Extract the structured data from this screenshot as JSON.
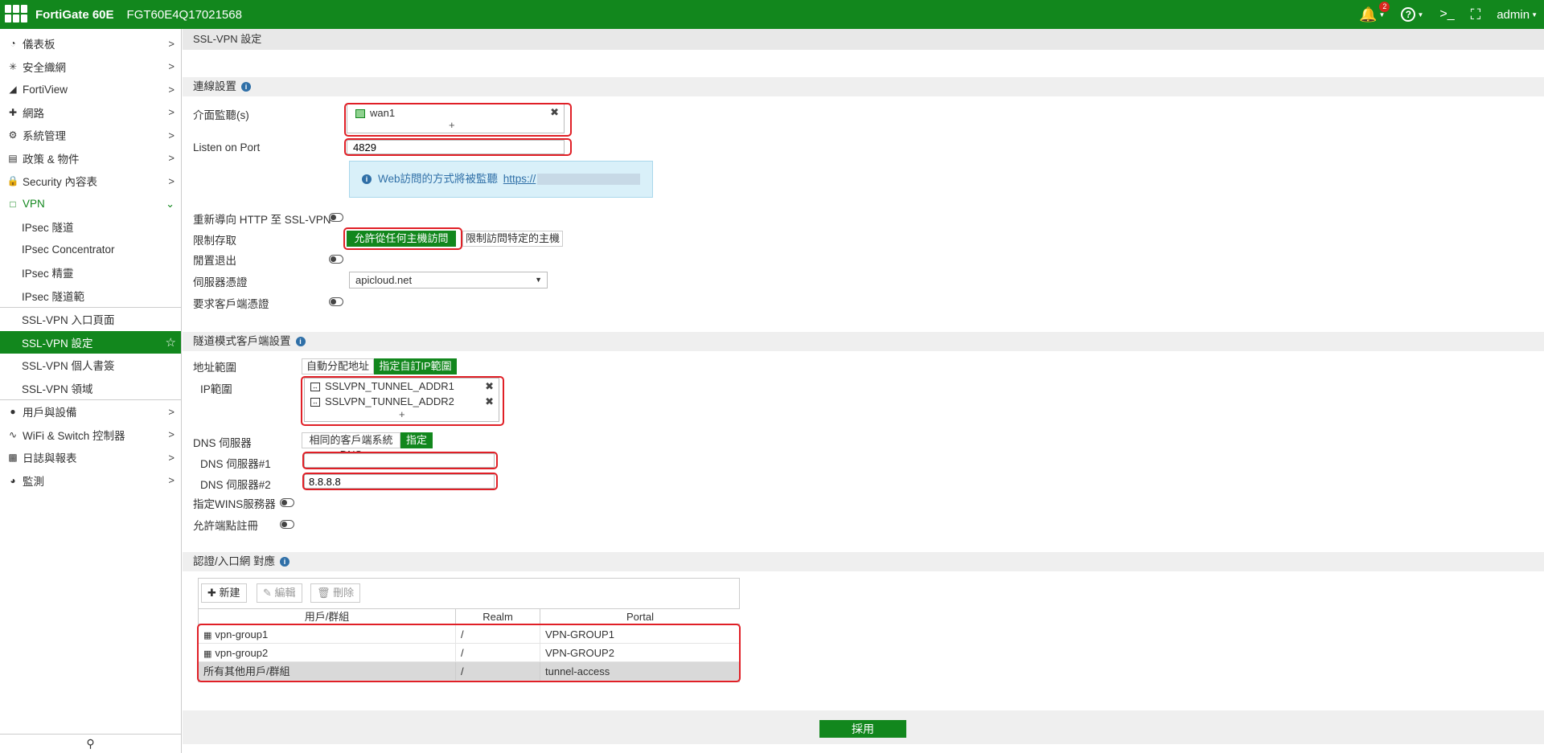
{
  "topbar": {
    "brand": "FortiGate 60E",
    "serial": "FGT60E4Q17021568",
    "notif_count": "2",
    "user": "admin"
  },
  "sidebar": {
    "items": [
      {
        "label": "儀表板",
        "icon": "dashboard-icon"
      },
      {
        "label": "安全織網",
        "icon": "fabric-icon"
      },
      {
        "label": "FortiView",
        "icon": "chart-icon"
      },
      {
        "label": "網路",
        "icon": "network-icon"
      },
      {
        "label": "系統管理",
        "icon": "gear-icon"
      },
      {
        "label": "政策 & 物件",
        "icon": "policy-icon"
      },
      {
        "label": "Security 內容表",
        "icon": "lock-icon"
      },
      {
        "label": "VPN",
        "icon": "laptop-icon"
      }
    ],
    "vpn_sub": [
      "IPsec 隧道",
      "IPsec Concentrator",
      "IPsec 精靈",
      "IPsec 隧道範",
      "SSL-VPN 入口頁面",
      "SSL-VPN 設定",
      "SSL-VPN 個人書簽",
      "SSL-VPN 領域"
    ],
    "items2": [
      {
        "label": "用戶與設備",
        "icon": "user-icon"
      },
      {
        "label": "WiFi & Switch 控制器",
        "icon": "wifi-icon"
      },
      {
        "label": "日誌與報表",
        "icon": "log-icon"
      },
      {
        "label": "監測",
        "icon": "monitor-icon"
      }
    ]
  },
  "page": {
    "title": "SSL-VPN 設定",
    "conn_section": "連線設置",
    "listen_iface_label": "介面監聽(s)",
    "iface_value": "wan1",
    "listen_port_label": "Listen on Port",
    "listen_port": "4829",
    "info_text": "Web訪問的方式將被監聽",
    "info_link": "https://",
    "redirect_label": "重新導向 HTTP 至 SSL-VPN",
    "restrict_label": "限制存取",
    "allow_any": "允許從任何主機訪問",
    "allow_specific": "限制訪問特定的主機",
    "idle_label": "閒置退出",
    "cert_label": "伺服器憑證",
    "cert_value": "apicloud.net",
    "client_cert_label": "要求客戶端憑證",
    "tunnel_section": "隧道模式客戶端設置",
    "addr_range_label": "地址範圍",
    "auto_addr": "自動分配地址",
    "custom_ip": "指定自訂IP範圍",
    "ip_range_label": "IP範圍",
    "ip_ranges": [
      "SSLVPN_TUNNEL_ADDR1",
      "SSLVPN_TUNNEL_ADDR2"
    ],
    "dns_label": "DNS 伺服器",
    "dns_same": "相同的客戶端系統DNS",
    "dns_specify": "指定",
    "dns1_label": "DNS 伺服器#1",
    "dns2_label": "DNS 伺服器#2",
    "dns2_value": "8.8.8.8",
    "wins_label": "指定WINS服務器",
    "endpoint_label": "允許端點註冊",
    "auth_section": "認證/入口網 對應",
    "toolbar": {
      "new": "新建",
      "edit": "編輯",
      "delete": "刪除"
    },
    "table": {
      "headers": [
        "用戶/群組",
        "Realm",
        "Portal"
      ],
      "rows": [
        {
          "group": "vpn-group1",
          "realm": "/",
          "portal": "VPN-GROUP1"
        },
        {
          "group": "vpn-group2",
          "realm": "/",
          "portal": "VPN-GROUP2"
        },
        {
          "group": "所有其他用戶/群組",
          "realm": "/",
          "portal": "tunnel-access"
        }
      ]
    },
    "apply": "採用"
  }
}
